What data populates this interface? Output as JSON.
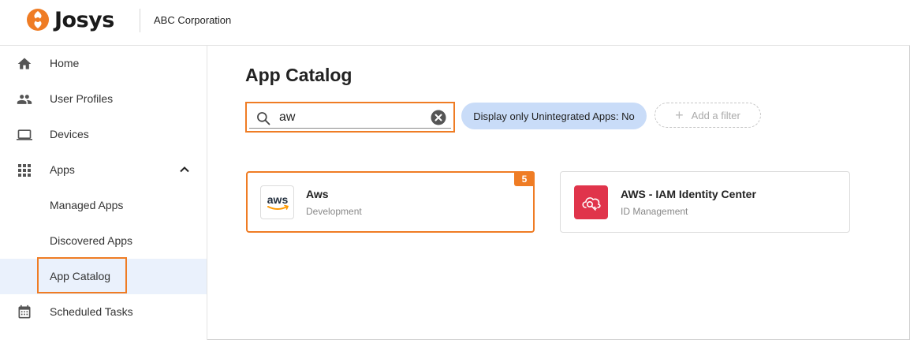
{
  "header": {
    "logo_text": "Josys",
    "org_name": "ABC Corporation",
    "brand_color": "#ef7c24"
  },
  "sidebar": {
    "items": [
      {
        "label": "Home",
        "icon": "home-icon"
      },
      {
        "label": "User Profiles",
        "icon": "people-icon"
      },
      {
        "label": "Devices",
        "icon": "laptop-icon"
      },
      {
        "label": "Apps",
        "icon": "grid-icon",
        "expanded": true
      },
      {
        "label": "Managed Apps"
      },
      {
        "label": "Discovered Apps"
      },
      {
        "label": "App Catalog",
        "active": true
      },
      {
        "label": "Scheduled Tasks",
        "icon": "calendar-icon"
      }
    ]
  },
  "main": {
    "title": "App Catalog",
    "search": {
      "value": "aw"
    },
    "filter_chip": "Display only Unintegrated Apps: No",
    "add_filter": "Add a filter",
    "cards": [
      {
        "name": "Aws",
        "category": "Development",
        "badge": "5",
        "logo_text": "aws"
      },
      {
        "name": "AWS - IAM Identity Center",
        "category": "ID Management",
        "logo_color": "#e0344b"
      }
    ]
  }
}
